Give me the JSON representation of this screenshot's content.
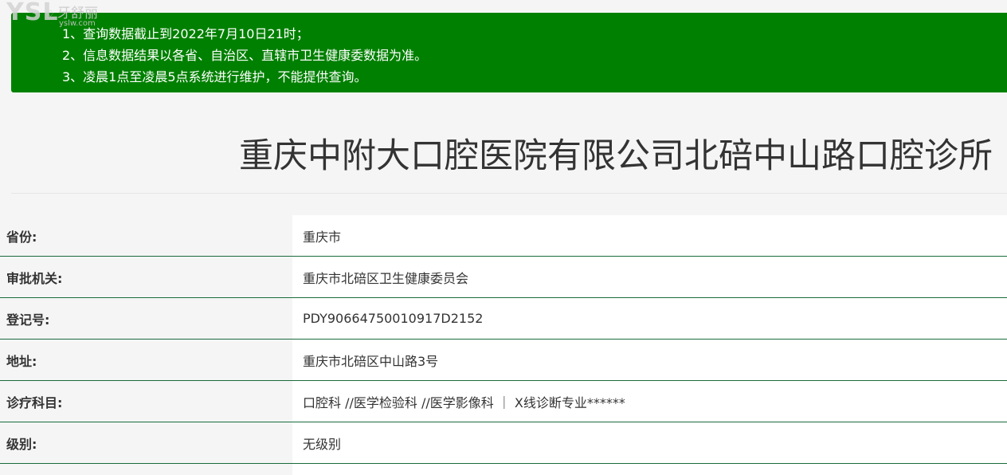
{
  "watermark": {
    "brand": "YSL",
    "name_cn": "牙舒丽",
    "url": "yslw.com"
  },
  "notice": {
    "lines": [
      "1、查询数据截止到2022年7月10日21时；",
      "2、信息数据结果以各省、自治区、直辖市卫生健康委数据为准。",
      "3、凌晨1点至凌晨5点系统进行维护，不能提供查询。"
    ]
  },
  "title": "重庆中附大口腔医院有限公司北碚中山路口腔诊所",
  "details": [
    {
      "label": "省份:",
      "value": "重庆市"
    },
    {
      "label": "审批机关:",
      "value": "重庆市北碚区卫生健康委员会"
    },
    {
      "label": "登记号:",
      "value": "PDY90664750010917D2152"
    },
    {
      "label": "地址:",
      "value": "重庆市北碚区中山路3号"
    },
    {
      "label": "诊疗科目:",
      "value": "口腔科 //医学检验科 //医学影像科 ｜ X线诊断专业******"
    },
    {
      "label": "级别:",
      "value": "无级别"
    }
  ],
  "colors": {
    "notice_bg": "#008000",
    "row_border": "#1a6b3c",
    "text": "#333333"
  }
}
